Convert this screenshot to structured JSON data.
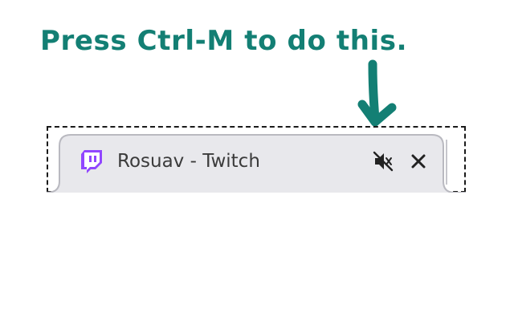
{
  "instruction": {
    "text": "Press Ctrl-M to do this.",
    "color": "#137f74"
  },
  "tab": {
    "title": "Rosuav - Twitch",
    "favicon_icon": "twitch-icon",
    "favicon_color": "#9146ff",
    "mute_icon": "speaker-muted-icon",
    "close_icon": "close-icon",
    "background": "#e8e8ec",
    "border": "#b9b9c0"
  },
  "arrow": {
    "icon": "arrow-down-icon",
    "color": "#137f74"
  }
}
